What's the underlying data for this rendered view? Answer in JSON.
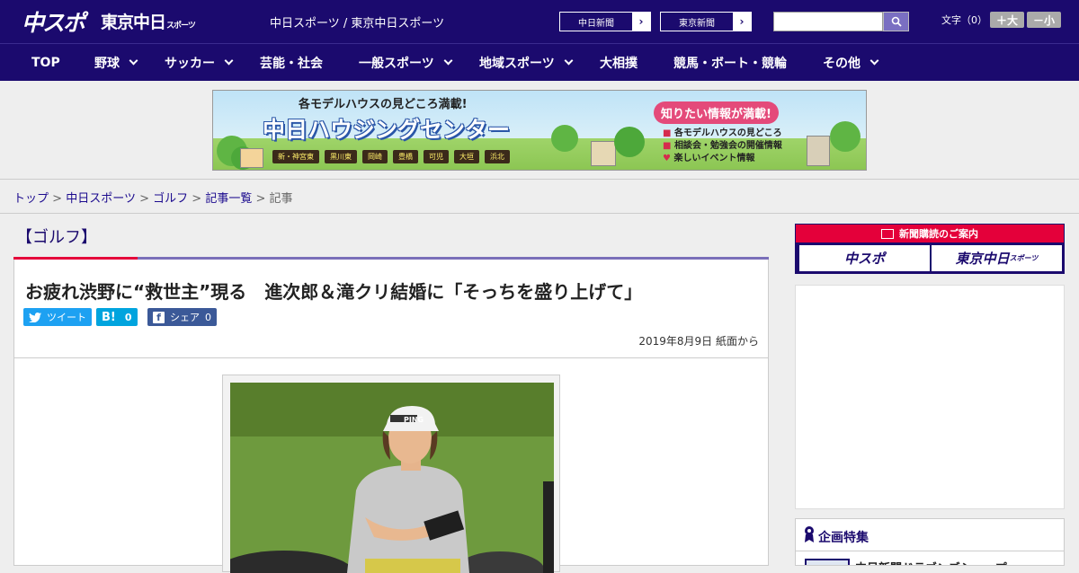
{
  "header": {
    "logo_chuspo": "中スポ",
    "logo_tokyo": "東京中日",
    "logo_tokyo_small": "スポーツ",
    "site_links": "中日スポーツ / 東京中日スポーツ",
    "btn_chunichi": "中日新聞",
    "btn_tokyo": "東京新聞",
    "search_value": "",
    "font_label": "文字（0）",
    "font_larger": "＋大",
    "font_smaller": "－小"
  },
  "nav": {
    "items": [
      {
        "label": "TOP",
        "dropdown": false
      },
      {
        "label": "野球",
        "dropdown": true
      },
      {
        "label": "サッカー",
        "dropdown": true
      },
      {
        "label": "芸能・社会",
        "dropdown": false
      },
      {
        "label": "一般スポーツ",
        "dropdown": true
      },
      {
        "label": "地域スポーツ",
        "dropdown": true
      },
      {
        "label": "大相撲",
        "dropdown": false
      },
      {
        "label": "競馬・ボート・競輪",
        "dropdown": false
      },
      {
        "label": "その他",
        "dropdown": true
      }
    ]
  },
  "banner": {
    "line1": "各モデルハウスの見どころ満載!",
    "title": "中日ハウジングセンター",
    "locations": [
      "新・神宮東",
      "黒川東",
      "岡崎",
      "豊橋",
      "可児",
      "大垣",
      "浜北"
    ],
    "headline": "知りたい情報が満載!",
    "bullets": [
      "各モデルハウスの見どころ",
      "相談会・勉強会の開催情報",
      "楽しいイベント情報"
    ]
  },
  "breadcrumb": {
    "items": [
      "トップ",
      "中日スポーツ",
      "ゴルフ",
      "記事一覧"
    ],
    "current": "記事",
    "separator": ">"
  },
  "article": {
    "category": "【ゴルフ】",
    "title": "お疲れ渋野に“救世主”現る　進次郎＆滝クリ結婚に「そっちを盛り上げて」",
    "share": {
      "tweet": "ツイート",
      "hatena": "B!",
      "hatena_count": "0",
      "facebook": "シェア",
      "facebook_count": "0"
    },
    "date": "2019年8月9日 紙面から",
    "photo_cap_text": "PING"
  },
  "sidebar": {
    "subscribe_header": "新聞購読のご案内",
    "subscribe_chuspo": "中スポ",
    "subscribe_tokyo": "東京中日",
    "subscribe_tokyo_small": "スポーツ",
    "feature_title": "企画特集",
    "feature_item": "中日新聞ドラゴンズショップ"
  },
  "colors": {
    "brand_navy": "#1b0a6e",
    "accent_red": "#e4003a",
    "twitter": "#1da1f2",
    "hatena": "#00a4de",
    "facebook": "#3b5998"
  }
}
